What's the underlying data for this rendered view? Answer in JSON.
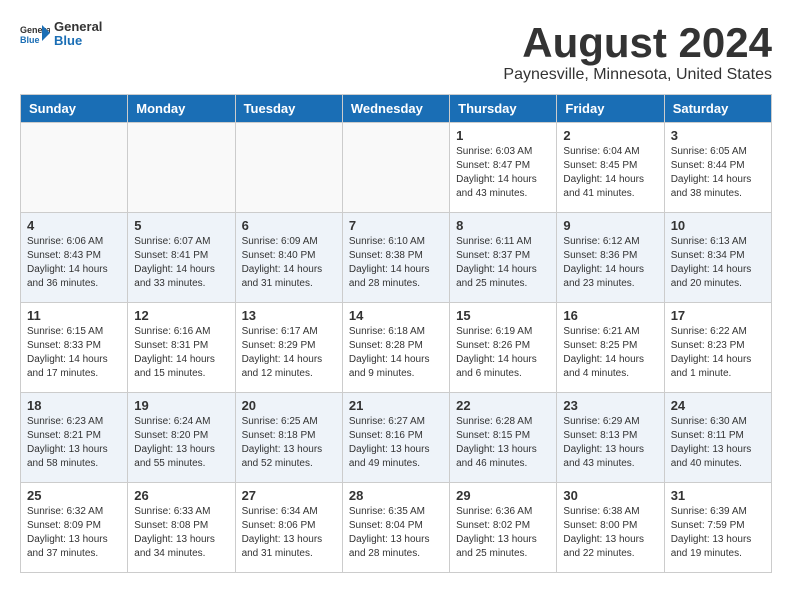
{
  "header": {
    "logo_general": "General",
    "logo_blue": "Blue",
    "title": "August 2024",
    "subtitle": "Paynesville, Minnesota, United States"
  },
  "calendar": {
    "headers": [
      "Sunday",
      "Monday",
      "Tuesday",
      "Wednesday",
      "Thursday",
      "Friday",
      "Saturday"
    ],
    "weeks": [
      [
        {
          "date": "",
          "info": ""
        },
        {
          "date": "",
          "info": ""
        },
        {
          "date": "",
          "info": ""
        },
        {
          "date": "",
          "info": ""
        },
        {
          "date": "1",
          "info": "Sunrise: 6:03 AM\nSunset: 8:47 PM\nDaylight: 14 hours\nand 43 minutes."
        },
        {
          "date": "2",
          "info": "Sunrise: 6:04 AM\nSunset: 8:45 PM\nDaylight: 14 hours\nand 41 minutes."
        },
        {
          "date": "3",
          "info": "Sunrise: 6:05 AM\nSunset: 8:44 PM\nDaylight: 14 hours\nand 38 minutes."
        }
      ],
      [
        {
          "date": "4",
          "info": "Sunrise: 6:06 AM\nSunset: 8:43 PM\nDaylight: 14 hours\nand 36 minutes."
        },
        {
          "date": "5",
          "info": "Sunrise: 6:07 AM\nSunset: 8:41 PM\nDaylight: 14 hours\nand 33 minutes."
        },
        {
          "date": "6",
          "info": "Sunrise: 6:09 AM\nSunset: 8:40 PM\nDaylight: 14 hours\nand 31 minutes."
        },
        {
          "date": "7",
          "info": "Sunrise: 6:10 AM\nSunset: 8:38 PM\nDaylight: 14 hours\nand 28 minutes."
        },
        {
          "date": "8",
          "info": "Sunrise: 6:11 AM\nSunset: 8:37 PM\nDaylight: 14 hours\nand 25 minutes."
        },
        {
          "date": "9",
          "info": "Sunrise: 6:12 AM\nSunset: 8:36 PM\nDaylight: 14 hours\nand 23 minutes."
        },
        {
          "date": "10",
          "info": "Sunrise: 6:13 AM\nSunset: 8:34 PM\nDaylight: 14 hours\nand 20 minutes."
        }
      ],
      [
        {
          "date": "11",
          "info": "Sunrise: 6:15 AM\nSunset: 8:33 PM\nDaylight: 14 hours\nand 17 minutes."
        },
        {
          "date": "12",
          "info": "Sunrise: 6:16 AM\nSunset: 8:31 PM\nDaylight: 14 hours\nand 15 minutes."
        },
        {
          "date": "13",
          "info": "Sunrise: 6:17 AM\nSunset: 8:29 PM\nDaylight: 14 hours\nand 12 minutes."
        },
        {
          "date": "14",
          "info": "Sunrise: 6:18 AM\nSunset: 8:28 PM\nDaylight: 14 hours\nand 9 minutes."
        },
        {
          "date": "15",
          "info": "Sunrise: 6:19 AM\nSunset: 8:26 PM\nDaylight: 14 hours\nand 6 minutes."
        },
        {
          "date": "16",
          "info": "Sunrise: 6:21 AM\nSunset: 8:25 PM\nDaylight: 14 hours\nand 4 minutes."
        },
        {
          "date": "17",
          "info": "Sunrise: 6:22 AM\nSunset: 8:23 PM\nDaylight: 14 hours\nand 1 minute."
        }
      ],
      [
        {
          "date": "18",
          "info": "Sunrise: 6:23 AM\nSunset: 8:21 PM\nDaylight: 13 hours\nand 58 minutes."
        },
        {
          "date": "19",
          "info": "Sunrise: 6:24 AM\nSunset: 8:20 PM\nDaylight: 13 hours\nand 55 minutes."
        },
        {
          "date": "20",
          "info": "Sunrise: 6:25 AM\nSunset: 8:18 PM\nDaylight: 13 hours\nand 52 minutes."
        },
        {
          "date": "21",
          "info": "Sunrise: 6:27 AM\nSunset: 8:16 PM\nDaylight: 13 hours\nand 49 minutes."
        },
        {
          "date": "22",
          "info": "Sunrise: 6:28 AM\nSunset: 8:15 PM\nDaylight: 13 hours\nand 46 minutes."
        },
        {
          "date": "23",
          "info": "Sunrise: 6:29 AM\nSunset: 8:13 PM\nDaylight: 13 hours\nand 43 minutes."
        },
        {
          "date": "24",
          "info": "Sunrise: 6:30 AM\nSunset: 8:11 PM\nDaylight: 13 hours\nand 40 minutes."
        }
      ],
      [
        {
          "date": "25",
          "info": "Sunrise: 6:32 AM\nSunset: 8:09 PM\nDaylight: 13 hours\nand 37 minutes."
        },
        {
          "date": "26",
          "info": "Sunrise: 6:33 AM\nSunset: 8:08 PM\nDaylight: 13 hours\nand 34 minutes."
        },
        {
          "date": "27",
          "info": "Sunrise: 6:34 AM\nSunset: 8:06 PM\nDaylight: 13 hours\nand 31 minutes."
        },
        {
          "date": "28",
          "info": "Sunrise: 6:35 AM\nSunset: 8:04 PM\nDaylight: 13 hours\nand 28 minutes."
        },
        {
          "date": "29",
          "info": "Sunrise: 6:36 AM\nSunset: 8:02 PM\nDaylight: 13 hours\nand 25 minutes."
        },
        {
          "date": "30",
          "info": "Sunrise: 6:38 AM\nSunset: 8:00 PM\nDaylight: 13 hours\nand 22 minutes."
        },
        {
          "date": "31",
          "info": "Sunrise: 6:39 AM\nSunset: 7:59 PM\nDaylight: 13 hours\nand 19 minutes."
        }
      ]
    ]
  }
}
